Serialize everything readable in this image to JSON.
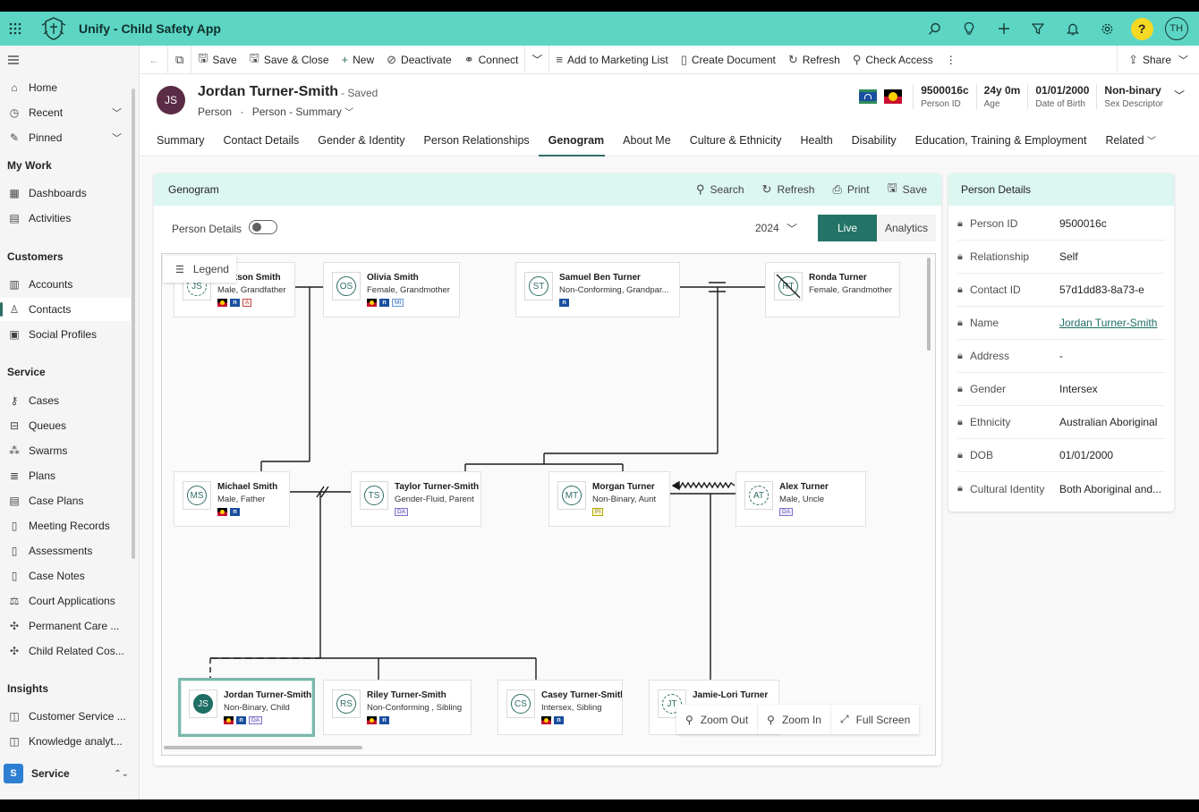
{
  "app": {
    "title": "Unify - Child Safety App",
    "user_initials": "TH"
  },
  "top_icons": [
    "search-icon",
    "lightbulb-icon",
    "plus-icon",
    "filter-icon",
    "bell-icon",
    "gear-icon",
    "help-icon"
  ],
  "nav": {
    "items_top": [
      {
        "label": "Home",
        "icon": "home-icon"
      },
      {
        "label": "Recent",
        "icon": "clock-icon"
      },
      {
        "label": "Pinned",
        "icon": "pin-icon"
      }
    ],
    "sections": [
      {
        "title": "My Work",
        "items": [
          "Dashboards",
          "Activities"
        ]
      },
      {
        "title": "Customers",
        "items": [
          "Accounts",
          "Contacts",
          "Social Profiles"
        ]
      },
      {
        "title": "Service",
        "items": [
          "Cases",
          "Queues",
          "Swarms",
          "Plans",
          "Case Plans",
          "Meeting Records",
          "Assessments",
          "Case Notes",
          "Court Applications",
          "Permanent Care ...",
          "Child Related Cos..."
        ]
      },
      {
        "title": "Insights",
        "items": [
          "Customer Service ...",
          "Knowledge analyt..."
        ]
      }
    ],
    "area": {
      "badge": "S",
      "label": "Service"
    }
  },
  "commands": [
    "Save",
    "Save & Close",
    "New",
    "Deactivate",
    "Connect",
    "Add to Marketing List",
    "Create Document",
    "Refresh",
    "Check Access",
    "Share"
  ],
  "record": {
    "initials": "JS",
    "name": "Jordan Turner-Smith",
    "saved": "- Saved",
    "entity": "Person",
    "form": "Person - Summary",
    "fields": [
      {
        "value": "9500016c",
        "label": "Person ID"
      },
      {
        "value": "24y 0m",
        "label": "Age"
      },
      {
        "value": "01/01/2000",
        "label": "Date of Birth"
      },
      {
        "value": "Non-binary",
        "label": "Sex Descriptor"
      }
    ],
    "tabs": [
      "Summary",
      "Contact Details",
      "Gender & Identity",
      "Person Relationships",
      "Genogram",
      "About Me",
      "Culture & Ethnicity",
      "Health",
      "Disability",
      "Education, Training & Employment",
      "Related"
    ]
  },
  "genogram": {
    "title": "Genogram",
    "actions": [
      "Search",
      "Refresh",
      "Print",
      "Save"
    ],
    "toggle_label": "Person Details",
    "year": "2024",
    "view_live": "Live",
    "view_analytics": "Analytics",
    "legend": "Legend",
    "zoom": {
      "out": "Zoom Out",
      "in": "Zoom In",
      "full": "Full Screen"
    },
    "people": [
      {
        "initials": "JS",
        "name": "Jackson Smith",
        "role": "Male, Grandfather",
        "badges": [
          "ab",
          "ts",
          "A"
        ]
      },
      {
        "initials": "OS",
        "name": "Olivia Smith",
        "role": "Female, Grandmother",
        "badges": [
          "ab",
          "ts",
          "MI"
        ]
      },
      {
        "initials": "ST",
        "name": "Samuel Ben Turner",
        "role": "Non-Conforming, Grandpar...",
        "badges": [
          "ts"
        ]
      },
      {
        "initials": "RT",
        "name": "Ronda Turner",
        "role": "Female, Grandmother",
        "badges": []
      },
      {
        "initials": "MS",
        "name": "Michael Smith",
        "role": "Male, Father",
        "badges": [
          "ab",
          "ts"
        ]
      },
      {
        "initials": "TS",
        "name": "Taylor Turner-Smith",
        "role": "Gender-Fluid, Parent",
        "badges": [
          "DA"
        ]
      },
      {
        "initials": "MT",
        "name": "Morgan Turner",
        "role": "Non-Binary, Aunt",
        "badges": [
          "PI"
        ]
      },
      {
        "initials": "AT",
        "name": "Alex Turner",
        "role": "Male, Uncle",
        "badges": [
          "DA"
        ]
      },
      {
        "initials": "JS",
        "name": "Jordan Turner-Smith",
        "role": "Non-Binary, Child",
        "badges": [
          "ab",
          "ts",
          "DA"
        ]
      },
      {
        "initials": "RS",
        "name": "Riley Turner-Smith",
        "role": "Non-Conforming , Sibling",
        "badges": [
          "ab",
          "ts"
        ]
      },
      {
        "initials": "CS",
        "name": "Casey Turner-Smith",
        "role": "Intersex, Sibling",
        "badges": [
          "ab",
          "ts"
        ]
      },
      {
        "initials": "JT",
        "name": "Jamie-Lori Turner",
        "role": "",
        "badges": []
      }
    ]
  },
  "person_details": {
    "title": "Person Details",
    "rows": [
      {
        "label": "Person ID",
        "value": "9500016c"
      },
      {
        "label": "Relationship",
        "value": "Self"
      },
      {
        "label": "Contact ID",
        "value": "57d1dd83-8a73-e"
      },
      {
        "label": "Name",
        "value": "Jordan Turner-Smith"
      },
      {
        "label": "Address",
        "value": "-"
      },
      {
        "label": "Gender",
        "value": "Intersex"
      },
      {
        "label": "Ethnicity",
        "value": "Australian Aboriginal"
      },
      {
        "label": "DOB",
        "value": "01/01/2000"
      },
      {
        "label": "Cultural Identity",
        "value": "Both Aboriginal and..."
      }
    ]
  },
  "colors": {
    "accent": "#5cd5c4",
    "primary": "#237466",
    "panel_head": "#dcf6f1"
  }
}
